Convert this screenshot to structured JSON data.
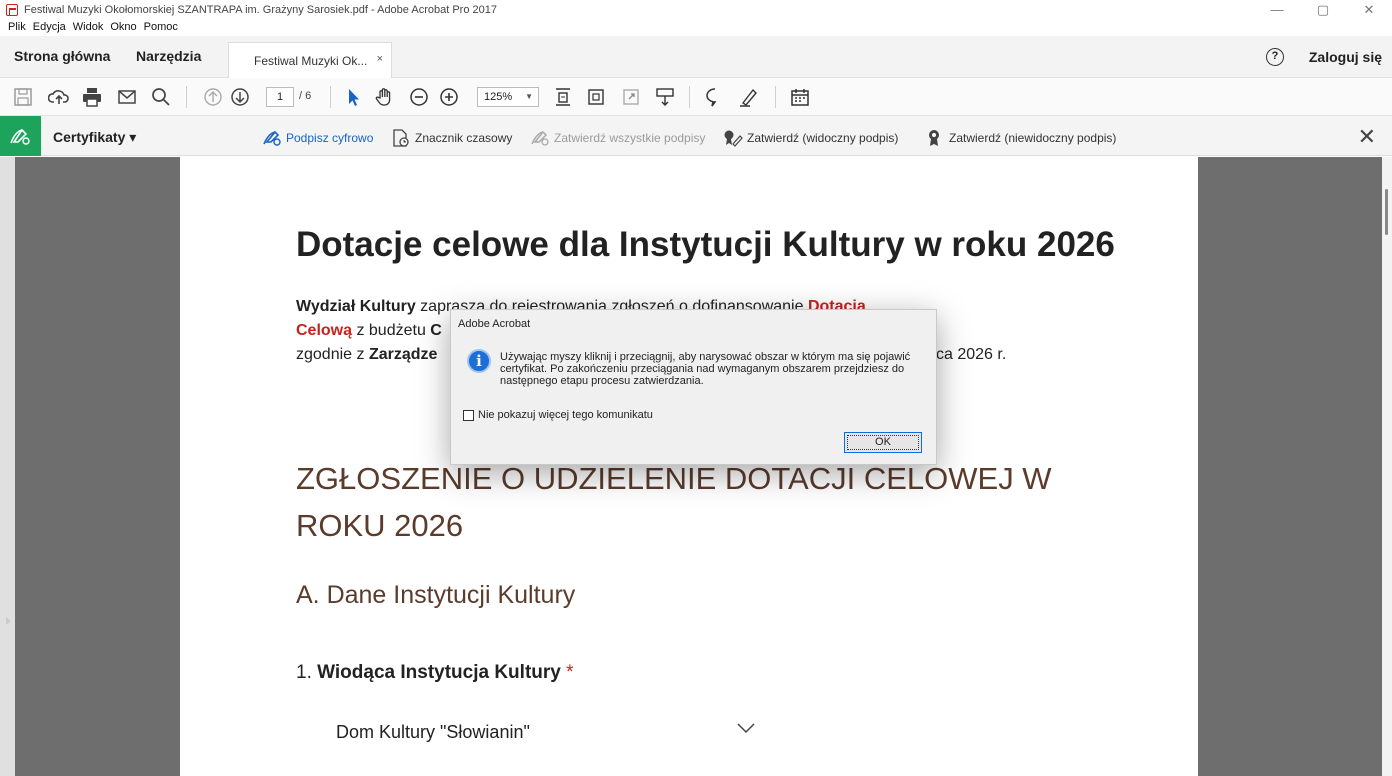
{
  "window": {
    "title": "Festiwal Muzyki Okołomorskiej SZANTRAPA im. Grażyny Sarosiek.pdf - Adobe Acrobat Pro 2017",
    "minimize": "—",
    "maximize": "▢",
    "close": "✕"
  },
  "menu": {
    "items": [
      "Plik",
      "Edycja",
      "Widok",
      "Okno",
      "Pomoc"
    ]
  },
  "nav": {
    "home": "Strona główna",
    "tools": "Narzędzia",
    "doc_tab": "Festiwal Muzyki Ok...",
    "doc_tab_close": "×",
    "help": "?",
    "login": "Zaloguj się"
  },
  "toolbar": {
    "page_current": "1",
    "page_total": "/ 6",
    "zoom": "125%",
    "zoom_arrow": "▼"
  },
  "certbar": {
    "label": "Certyfikaty ▾",
    "sign": "Podpisz cyfrowo",
    "timestamp": "Znacznik czasowy",
    "validate_all": "Zatwierdź wszystkie podpisy",
    "certify_visible": "Zatwierdź (widoczny podpis)",
    "certify_invisible": "Zatwierdź (niewidoczny podpis)",
    "close": "✕",
    "colors": {
      "accent": "#1da35c",
      "link": "#1a63c8",
      "disabled": "#9b9b9b"
    }
  },
  "document": {
    "title": "Dotacje celowe dla Instytucji Kultury w roku 2026",
    "intro_bold1": "Wydział Kultury",
    "intro_text1": " zaprasza do rejestrowania zgłoszeń o dofinansowanie ",
    "intro_red1": "Dotacja",
    "intro_red2": "Celową",
    "intro_text2": " z budżetu ",
    "intro_bold2": "C",
    "intro_text3": "zgodnie z ",
    "intro_bold3": "Zarządze",
    "intro_tail": "ca 2026 r.",
    "section_title": "ZGŁOSZENIE O UDZIELENIE DOTACJI CELOWEJ W ROKU 2026",
    "subsection": "A. Dane Instytucji Kultury",
    "question_num": "1. ",
    "question": "Wiodąca Instytucja Kultury",
    "required": " *",
    "answer": "Dom Kultury \"Słowianin\""
  },
  "dialog": {
    "title": "Adobe Acrobat",
    "message": "Używając myszy kliknij i przeciągnij, aby narysować obszar w którym ma się pojawić certyfikat. Po zakończeniu przeciągania nad wymaganym obszarem przejdziesz do następnego etapu procesu zatwierdzania.",
    "checkbox_label": "Nie pokazuj więcej tego komunikatu",
    "ok": "OK",
    "info_glyph": "i"
  }
}
